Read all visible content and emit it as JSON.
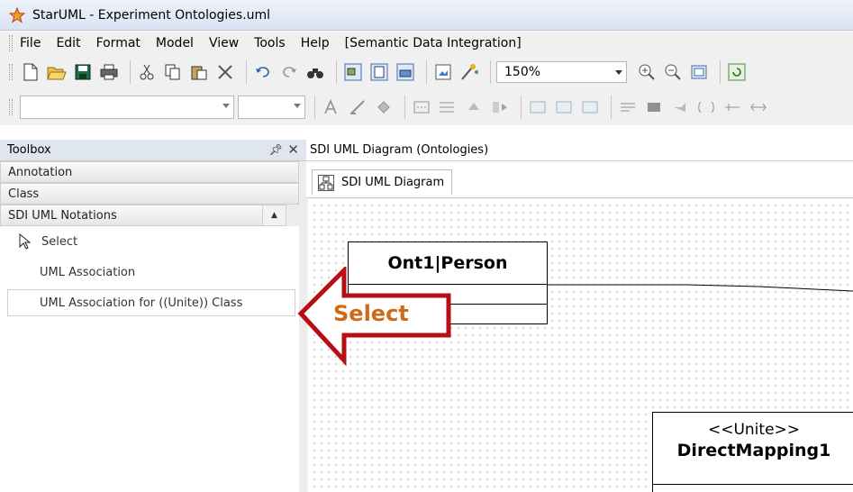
{
  "window": {
    "title": "StarUML - Experiment Ontologies.uml"
  },
  "menu": [
    "File",
    "Edit",
    "Format",
    "Model",
    "View",
    "Tools",
    "Help",
    "[Semantic Data Integration]"
  ],
  "toolbar": {
    "zoom": "150%"
  },
  "toolbox": {
    "title": "Toolbox",
    "categories": [
      "Annotation",
      "Class",
      "SDI UML Notations"
    ],
    "items": [
      "Select",
      "UML Association",
      "UML Association for ((Unite)) Class"
    ]
  },
  "document": {
    "header": "SDI UML Diagram (Ontologies)",
    "tab": "SDI UML Diagram"
  },
  "diagram": {
    "class1": {
      "name": "Ont1|Person"
    },
    "class2": {
      "stereotype": "<<Unite>>",
      "name": "DirectMapping1"
    }
  },
  "callout": {
    "label": "Select",
    "color": "#d06a17",
    "border_color": "#b80d14"
  }
}
